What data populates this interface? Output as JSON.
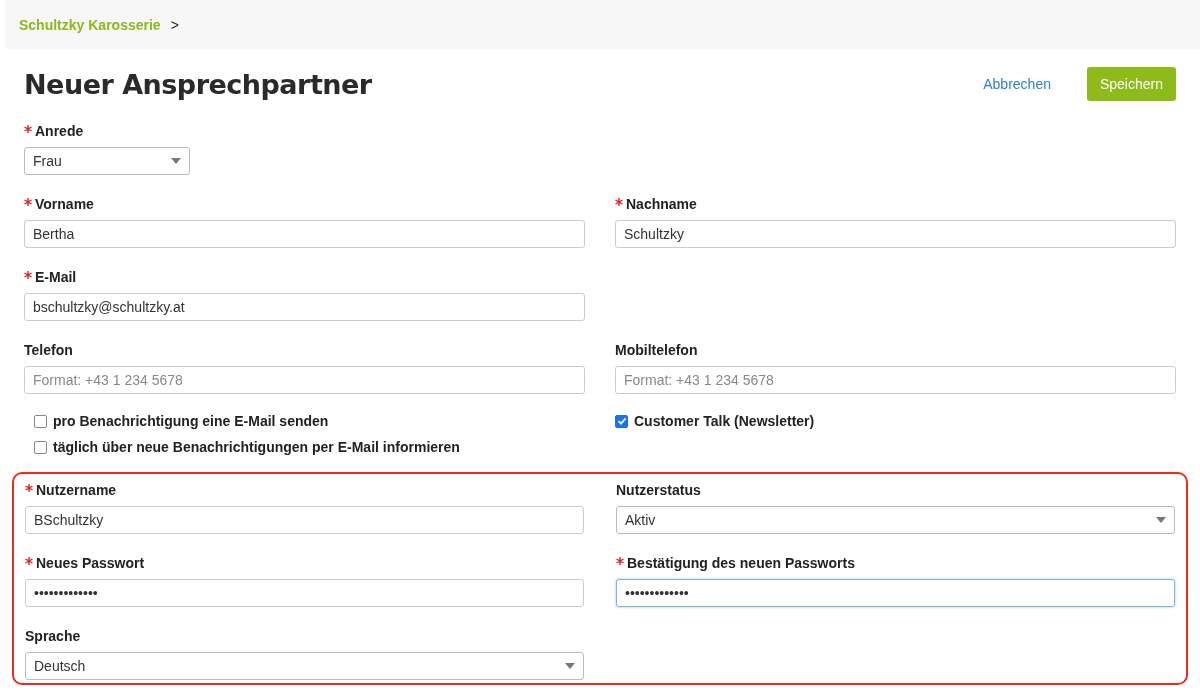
{
  "breadcrumb": {
    "items": [
      {
        "label": "Schultzky Karosserie"
      }
    ],
    "separator": ">"
  },
  "title": "Neuer Ansprechpartner",
  "actions": {
    "cancel": "Abbrechen",
    "save": "Speichern"
  },
  "salutation": {
    "label": "Anrede",
    "required": true,
    "value": "Frau"
  },
  "rows": [
    [
      {
        "kind": "text",
        "label": "Vorname",
        "required": true,
        "value": "Bertha"
      },
      {
        "kind": "text",
        "label": "Nachname",
        "required": true,
        "value": "Schultzky"
      }
    ],
    [
      {
        "kind": "text",
        "label": "E-Mail",
        "required": true,
        "value": "bschultzky@schultzky.at"
      }
    ],
    [
      {
        "kind": "text",
        "label": "Telefon",
        "required": false,
        "placeholder": "Format: +43 1 234 5678"
      },
      {
        "kind": "text",
        "label": "Mobiltelefon",
        "required": false,
        "placeholder": "Format: +43 1 234 5678"
      }
    ]
  ],
  "checkboxes": {
    "left": [
      {
        "label": "pro Benachrichtigung eine E-Mail senden",
        "checked": false
      },
      {
        "label": "täglich über neue Benachrichtigungen per E-Mail informieren",
        "checked": false
      }
    ],
    "right": [
      {
        "label": "Customer Talk (Newsletter)",
        "checked": true
      }
    ]
  },
  "account_section": {
    "highlighted": true,
    "rows": [
      [
        {
          "kind": "text",
          "label": "Nutzername",
          "required": true,
          "value": "BSchultzky"
        },
        {
          "kind": "select",
          "label": "Nutzerstatus",
          "required": false,
          "value": "Aktiv"
        }
      ],
      [
        {
          "kind": "password",
          "label": "Neues Passwort",
          "required": true,
          "value": "•••••••••••••",
          "focused": false
        },
        {
          "kind": "password",
          "label": "Bestätigung des neuen Passworts",
          "required": true,
          "value": "•••••••••••••",
          "focused": true
        }
      ],
      [
        {
          "kind": "select",
          "label": "Sprache",
          "required": false,
          "value": "Deutsch"
        }
      ]
    ]
  }
}
